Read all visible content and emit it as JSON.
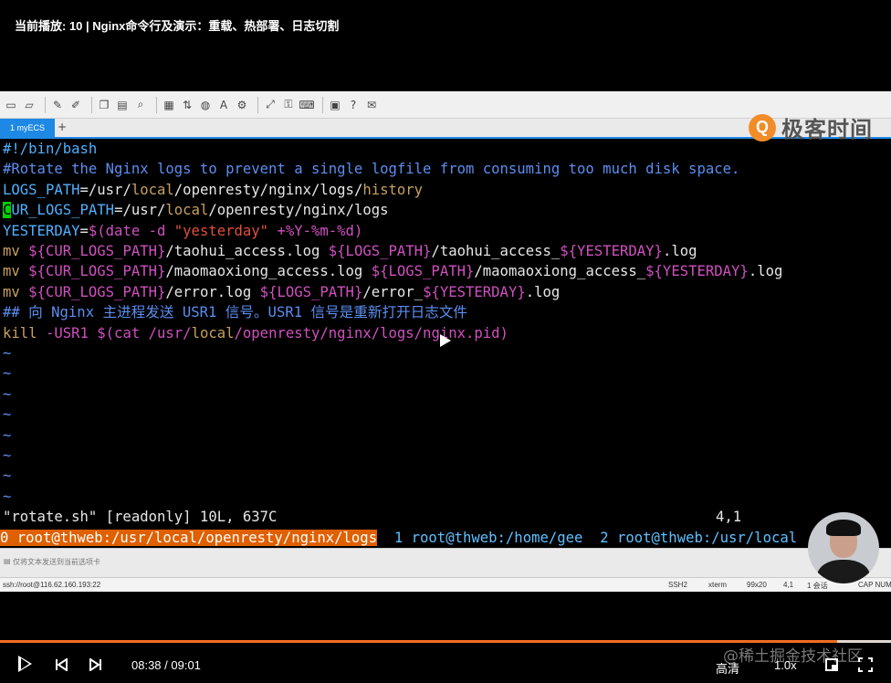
{
  "video": {
    "title": "当前播放: 10 | Nginx命令行及演示：重载、热部署、日志切割"
  },
  "app": {
    "tab_label": "1 myECS",
    "tab_add": "+",
    "toolbar_icons": [
      "new-session-icon",
      "open-icon",
      "edit-icon",
      "properties-icon",
      "copy-icon",
      "paste-icon",
      "find-icon",
      "print-icon",
      "transfer-icon",
      "globe-icon",
      "font-icon",
      "script-icon",
      "fullscreen-icon",
      "lock-icon",
      "keyboard-icon",
      "compose-icon",
      "help-icon",
      "chat-icon"
    ],
    "watermark_logo_text": "极客时间"
  },
  "terminal": {
    "lines": [
      [
        {
          "t": "#!/bin/bash",
          "c": "c-cyan"
        }
      ],
      [
        {
          "t": "#Rotate the Nginx logs to prevent a single logfile from consuming too much disk space.",
          "c": "c-blue"
        }
      ],
      [
        {
          "t": "LOGS_PATH",
          "c": "c-cyan"
        },
        {
          "t": "=/usr/",
          "c": "c-white"
        },
        {
          "t": "local",
          "c": "c-orange"
        },
        {
          "t": "/openresty/nginx/logs/",
          "c": "c-white"
        },
        {
          "t": "history",
          "c": "c-orange"
        }
      ],
      [
        {
          "t": "C",
          "c": "cursor"
        },
        {
          "t": "UR_LOGS_PATH",
          "c": "c-cyan"
        },
        {
          "t": "=/usr/",
          "c": "c-white"
        },
        {
          "t": "local",
          "c": "c-orange"
        },
        {
          "t": "/openresty/nginx/logs",
          "c": "c-white"
        }
      ],
      [
        {
          "t": "YESTERDAY",
          "c": "c-cyan"
        },
        {
          "t": "=",
          "c": "c-white"
        },
        {
          "t": "$(date -d ",
          "c": "c-mag"
        },
        {
          "t": "\"yesterday\"",
          "c": "c-red"
        },
        {
          "t": " +%Y-%m-%d)",
          "c": "c-mag"
        }
      ],
      [
        {
          "t": "mv ",
          "c": "c-orange"
        },
        {
          "t": "${CUR_LOGS_PATH}",
          "c": "c-mag"
        },
        {
          "t": "/taohui_access.log ",
          "c": "c-white"
        },
        {
          "t": "${LOGS_PATH}",
          "c": "c-mag"
        },
        {
          "t": "/taohui_access_",
          "c": "c-white"
        },
        {
          "t": "${YESTERDAY}",
          "c": "c-mag"
        },
        {
          "t": ".log",
          "c": "c-white"
        }
      ],
      [
        {
          "t": "mv ",
          "c": "c-orange"
        },
        {
          "t": "${CUR_LOGS_PATH}",
          "c": "c-mag"
        },
        {
          "t": "/maomaoxiong_access.log ",
          "c": "c-white"
        },
        {
          "t": "${LOGS_PATH}",
          "c": "c-mag"
        },
        {
          "t": "/maomaoxiong_access_",
          "c": "c-white"
        },
        {
          "t": "${YESTERDAY}",
          "c": "c-mag"
        },
        {
          "t": ".log",
          "c": "c-white"
        }
      ],
      [
        {
          "t": "mv ",
          "c": "c-orange"
        },
        {
          "t": "${CUR_LOGS_PATH}",
          "c": "c-mag"
        },
        {
          "t": "/error.log ",
          "c": "c-white"
        },
        {
          "t": "${LOGS_PATH}",
          "c": "c-mag"
        },
        {
          "t": "/error_",
          "c": "c-white"
        },
        {
          "t": "${YESTERDAY}",
          "c": "c-mag"
        },
        {
          "t": ".log",
          "c": "c-white"
        }
      ],
      [
        {
          "t": "## 向 Nginx 主进程发送 USR1 信号。USR1 信号是重新打开日志文件",
          "c": "c-blue"
        }
      ],
      [
        {
          "t": "kill ",
          "c": "c-orange"
        },
        {
          "t": "-USR1 $(cat /usr/",
          "c": "c-mag"
        },
        {
          "t": "local",
          "c": "c-orange"
        },
        {
          "t": "/openresty/nginx/logs/nginx.pid)",
          "c": "c-mag"
        }
      ]
    ],
    "tilde": "~",
    "tilde_count": 8,
    "status_message": "\"rotate.sh\" [readonly] 10L, 637C",
    "cursor_pos": "4,1"
  },
  "tmux": {
    "active_window": "0 root@thweb:/usr/local/openresty/nginx/logs",
    "window_1": "  1 root@thweb:/home/gee",
    "window_2": "  2 root@thweb:/usr/local"
  },
  "inputbar": {
    "text": "仅将文本发送到当前选项卡"
  },
  "statusrow": {
    "host": "ssh://root@116.62.160.193:22",
    "protocol": "SSH2",
    "terminal": "xterm",
    "size": "99x20",
    "position": "4,1",
    "sessions": "1 会话",
    "caps": "CAP NUM"
  },
  "player": {
    "progress": 0.94,
    "time": "08:38 / 09:01",
    "quality": "高清",
    "speed": "1.0x",
    "site_watermark": "@稀土掘金技术社区"
  }
}
